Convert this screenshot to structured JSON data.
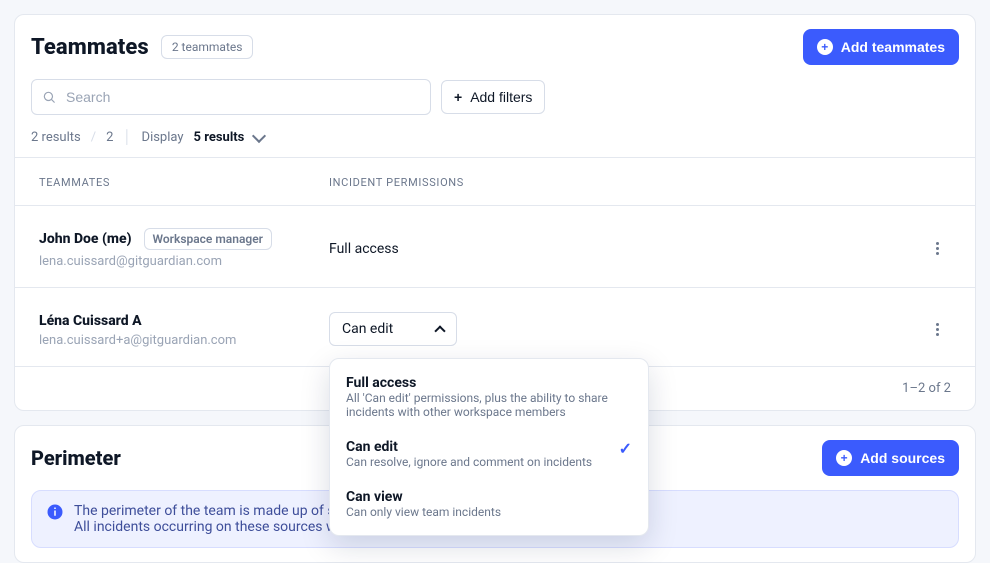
{
  "teammates": {
    "title": "Teammates",
    "count_label": "2 teammates",
    "add_label": "Add teammates",
    "search_placeholder": "Search",
    "add_filters_label": "Add filters",
    "results_text": "2 results",
    "results_total": "2",
    "display_label": "Display",
    "display_value": "5 results",
    "columns": {
      "teammates": "TEAMMATES",
      "permissions": "INCIDENT PERMISSIONS"
    },
    "rows": [
      {
        "name": "John Doe (me)",
        "role": "Workspace manager",
        "email": "lena.cuissard@gitguardian.com",
        "permission_text": "Full access",
        "is_select": false
      },
      {
        "name": "Léna Cuissard A",
        "email": "lena.cuissard+a@gitguardian.com",
        "permission_value": "Can edit",
        "is_select": true
      }
    ],
    "dropdown": {
      "selected": "Can edit",
      "options": [
        {
          "title": "Full access",
          "desc": "All 'Can edit' permissions, plus the ability to share incidents with other workspace members"
        },
        {
          "title": "Can edit",
          "desc": "Can resolve, ignore and comment on incidents"
        },
        {
          "title": "Can view",
          "desc": "Can only view team incidents"
        }
      ]
    },
    "range_label": "1–2 of 2"
  },
  "perimeter": {
    "title": "Perimeter",
    "add_label": "Add sources",
    "info_line1": "The perimeter of the team is made up of sources.",
    "info_line2": "All incidents occurring on these sources will be accessible and notified to the team."
  }
}
